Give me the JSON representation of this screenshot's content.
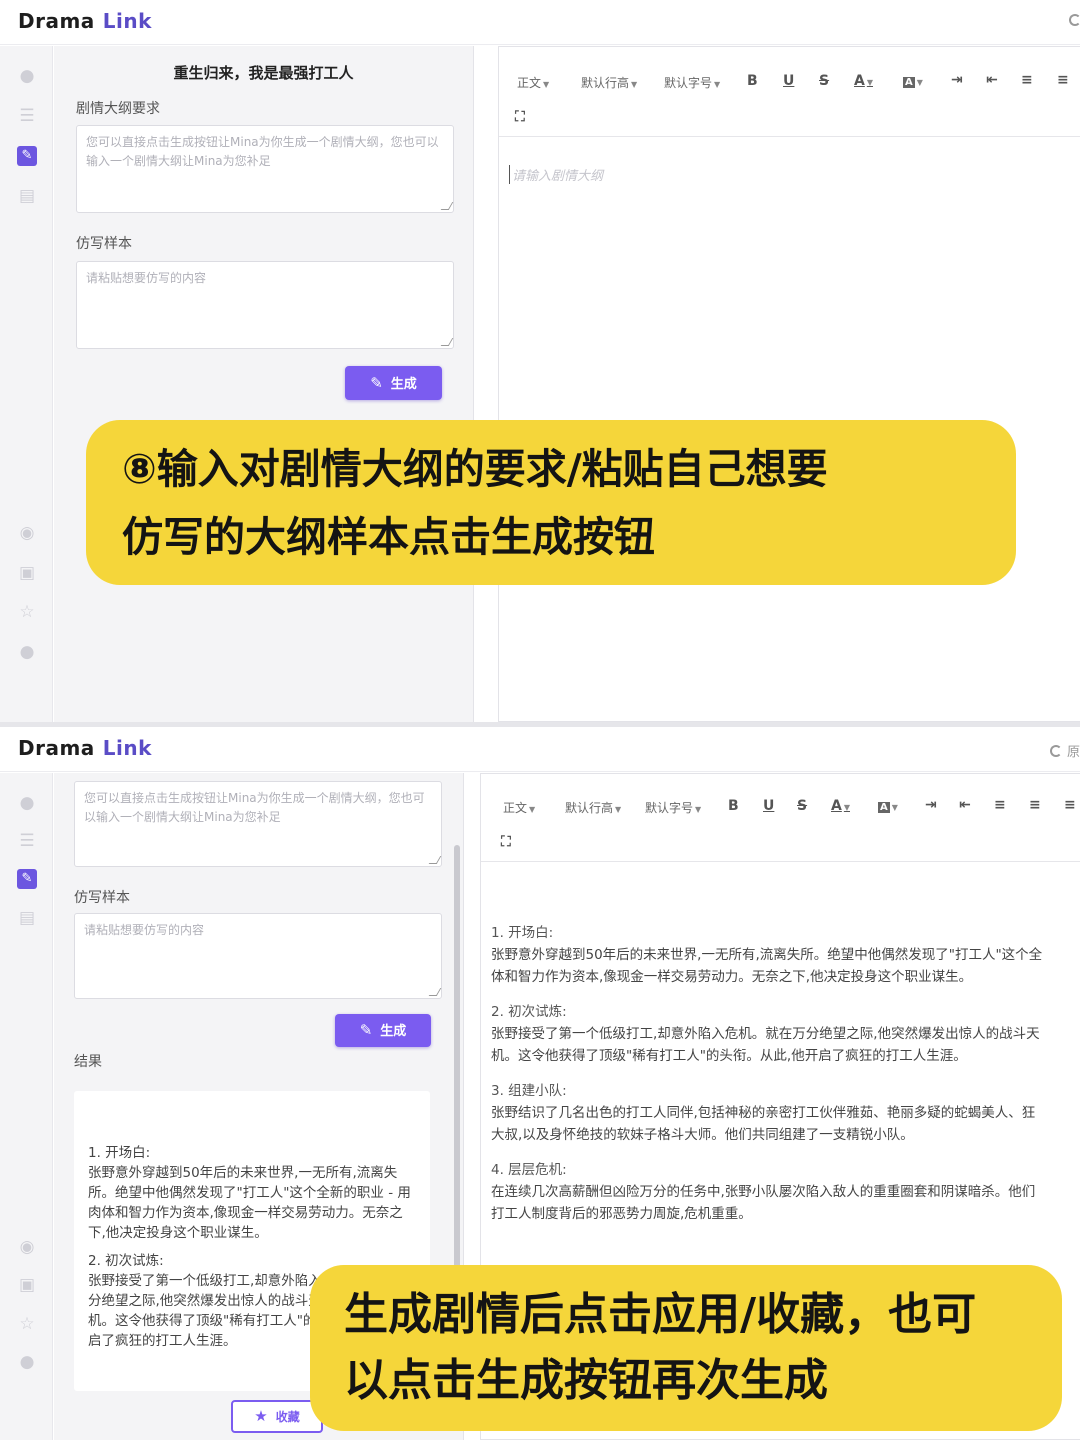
{
  "app": {
    "logo_part1": "Drama",
    "logo_part2": "Link",
    "header_right_label": "原"
  },
  "rail_icons": [
    "lightbulb-icon",
    "user-list-icon",
    "edit-document-icon",
    "notebook-icon",
    "eye-icon",
    "save-icon",
    "star-icon",
    "chat-icon"
  ],
  "screen1": {
    "form_title": "重生归来，我是最强打工人",
    "outline_label": "剧情大纲要求",
    "outline_placeholder": "您可以直接点击生成按钮让Mina为你生成一个剧情大纲，您也可以输入一个剧情大纲让Mina为您补足",
    "sample_label": "仿写样本",
    "sample_placeholder": "请粘贴想要仿写的内容",
    "generate_label": "生成",
    "editor_placeholder": "请输入剧情大纲"
  },
  "toolbar": {
    "style": "正文",
    "line_height": "默认行高",
    "font_size": "默认字号",
    "bold": "B",
    "underline": "U",
    "strike": "S",
    "font_color": "A",
    "bg_color": "A"
  },
  "screen2": {
    "outline_placeholder": "您可以直接点击生成按钮让Mina为你生成一个剧情大纲，您也可以输入一个剧情大纲让Mina为您补足",
    "sample_label": "仿写样本",
    "sample_placeholder": "请粘贴想要仿写的内容",
    "generate_label": "生成",
    "result_label": "结果",
    "result_p1_title": "1. 开场白:",
    "result_p1_body": "张野意外穿越到50年后的未来世界,一无所有,流离失所。绝望中他偶然发现了\"打工人\"这个全新的职业 - 用肉体和智力作为资本,像现金一样交易劳动力。无奈之下,他决定投身这个职业谋生。",
    "result_p2_title": "2. 初次试炼:",
    "result_p2_body": "张野接受了第一个低级打工,却意外陷入危机。就在万分绝望之际,他突然爆发出惊人的战斗天赋,举化解危机。这令他获得了顶级\"稀有打工人\"的头衔。从此,他开启了疯狂的打工人生涯。",
    "favorite_label": "收藏",
    "doc": [
      {
        "title": "1. 开场白:",
        "lines": [
          "张野意外穿越到50年后的未来世界,一无所有,流离失所。绝望中他偶然发现了\"打工人\"这个全",
          "体和智力作为资本,像现金一样交易劳动力。无奈之下,他决定投身这个职业谋生。"
        ]
      },
      {
        "title": "2. 初次试炼:",
        "lines": [
          "张野接受了第一个低级打工,却意外陷入危机。就在万分绝望之际,他突然爆发出惊人的战斗天",
          "机。这令他获得了顶级\"稀有打工人\"的头衔。从此,他开启了疯狂的打工人生涯。"
        ]
      },
      {
        "title": "3. 组建小队:",
        "lines": [
          "张野结识了几名出色的打工人同伴,包括神秘的亲密打工伙伴雅茹、艳丽多疑的蛇蝎美人、狂",
          "大叔,以及身怀绝技的软妹子格斗大师。他们共同组建了一支精锐小队。"
        ]
      },
      {
        "title": "4. 层层危机:",
        "lines": [
          "在连续几次高薪酬但凶险万分的任务中,张野小队屡次陷入敌人的重重圈套和阴谋暗杀。他们",
          "打工人制度背后的邪恶势力周旋,危机重重。"
        ]
      }
    ]
  },
  "callouts": {
    "step8_line1": "⑧输入对剧情大纲的要求/粘贴自己想要",
    "step8_line2": "仿写的大纲样本点击生成按钮",
    "after_line1": "生成剧情后点击应用/收藏，也可",
    "after_line2": "以点击生成按钮再次生成"
  }
}
